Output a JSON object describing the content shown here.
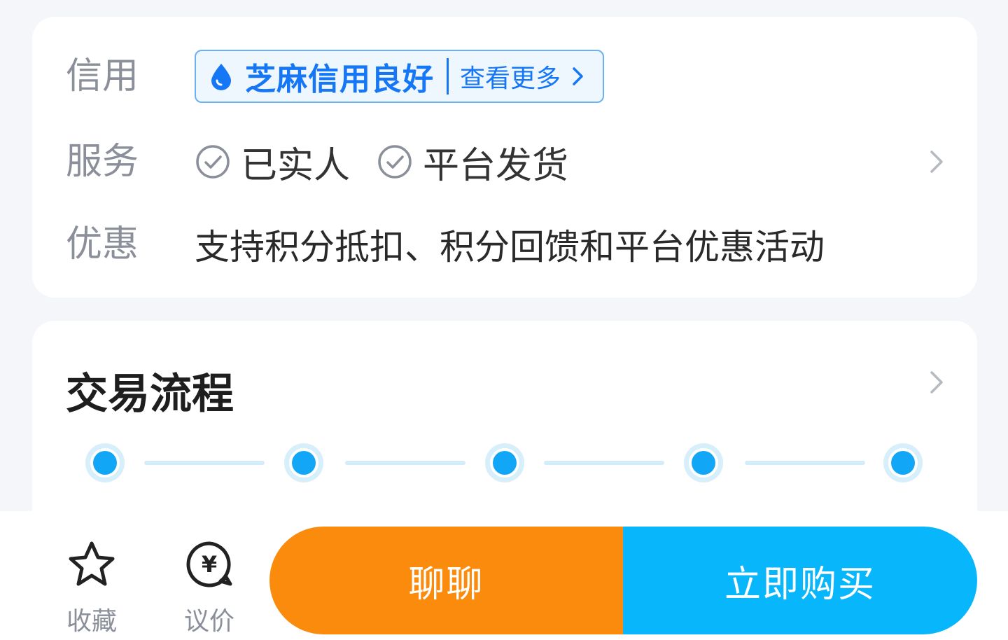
{
  "info": {
    "credit": {
      "label": "信用",
      "badge_icon": "sesame-drop-icon",
      "badge_text": "芝麻信用良好",
      "more_text": "查看更多"
    },
    "service": {
      "label": "服务",
      "items": [
        "已实人",
        "平台发货"
      ]
    },
    "promo": {
      "label": "优惠",
      "text": "支持积分抵扣、积分回馈和平台优惠活动"
    }
  },
  "process": {
    "title": "交易流程",
    "step_count": 5
  },
  "bottom": {
    "favorite_label": "收藏",
    "bargain_label": "议价",
    "chat_button": "聊聊",
    "buy_button": "立即购买"
  },
  "colors": {
    "accent_blue": "#1677f6",
    "step_blue": "#12a6f6",
    "chat_orange": "#fa8b0c",
    "buy_blue": "#08b6fb"
  }
}
